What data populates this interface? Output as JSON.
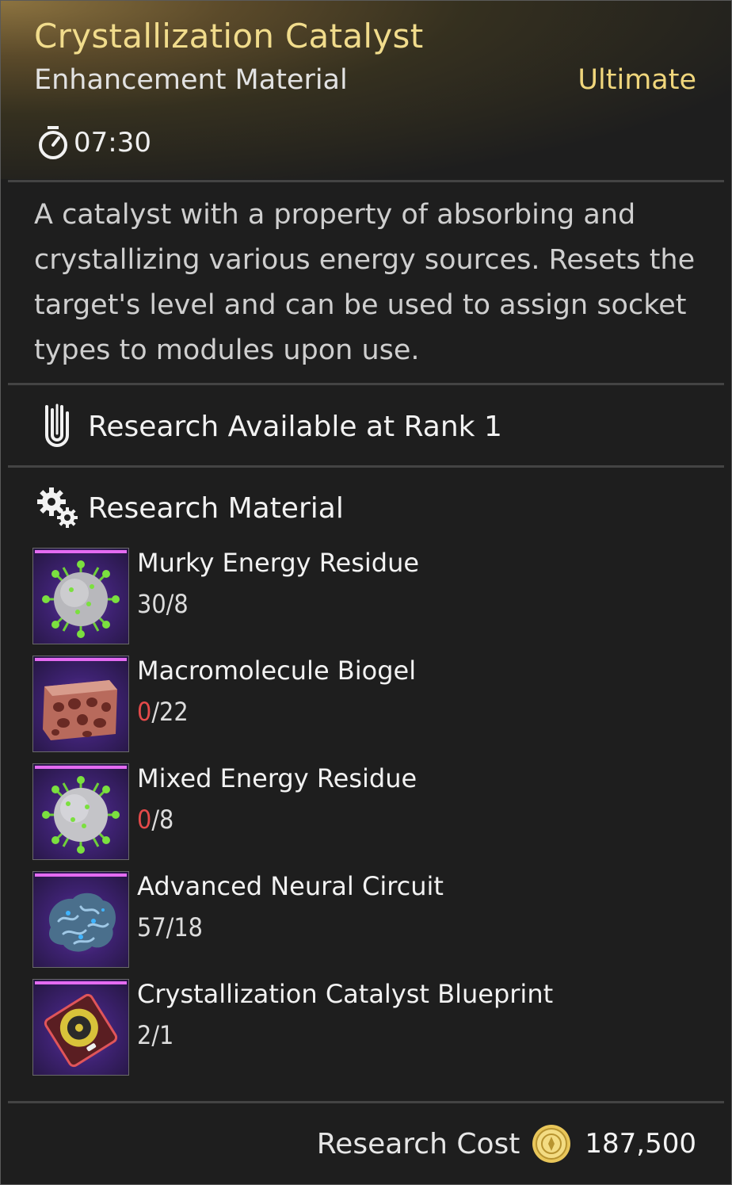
{
  "item": {
    "name": "Crystallization Catalyst",
    "type": "Enhancement Material",
    "grade": "Ultimate",
    "timer": "07:30",
    "description": "A catalyst with a property of absorbing and crystallizing various energy sources. Resets the target's level and can be used to assign socket types to modules upon use."
  },
  "research": {
    "rank_text": "Research Available at Rank 1",
    "material_heading": "Research Material",
    "materials": [
      {
        "name": "Murky Energy Residue",
        "have": "30",
        "need": "8",
        "icon": "virus-icon",
        "sufficient": true
      },
      {
        "name": "Macromolecule Biogel",
        "have": "0",
        "need": "22",
        "icon": "biogel-icon",
        "sufficient": false
      },
      {
        "name": "Mixed Energy Residue",
        "have": "0",
        "need": "8",
        "icon": "virus-icon",
        "sufficient": false
      },
      {
        "name": "Advanced Neural Circuit",
        "have": "57",
        "need": "18",
        "icon": "brain-icon",
        "sufficient": true
      },
      {
        "name": "Crystallization Catalyst Blueprint",
        "have": "2",
        "need": "1",
        "icon": "blueprint-disc-icon",
        "sufficient": true
      }
    ],
    "cost_label": "Research Cost",
    "cost_value": "187,500"
  },
  "colors": {
    "title": "#f1dc8c",
    "grade": "#f0d67c",
    "insufficient": "#e44a4a",
    "rarity_stripe": "#e46bf2"
  }
}
